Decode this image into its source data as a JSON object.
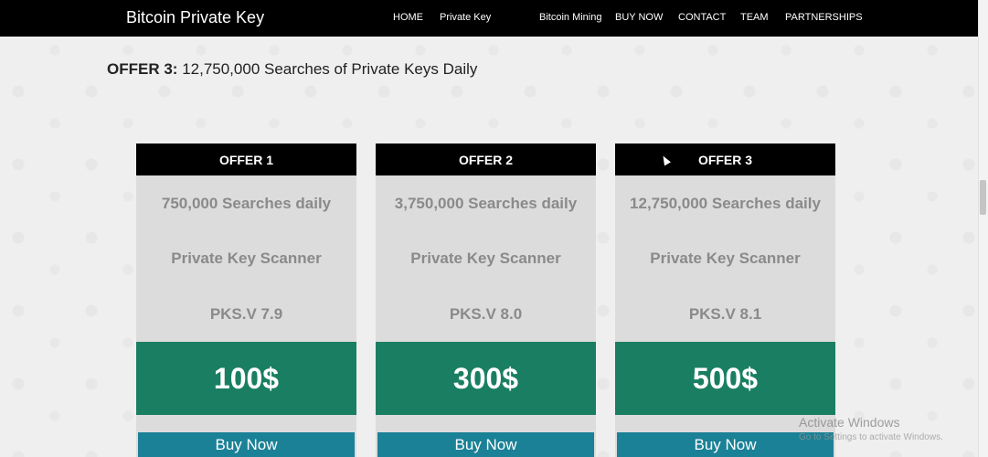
{
  "navbar": {
    "brand": "Bitcoin Private Key",
    "items": [
      "HOME",
      "Private Key",
      "Bitcoin Mining",
      "BUY NOW",
      "CONTACT",
      "TEAM",
      "PARTNERSHIPS"
    ]
  },
  "headline": {
    "label": "OFFER 3:",
    "text": "12,750,000 Searches of Private Keys Daily"
  },
  "offers": [
    {
      "title": "OFFER 1",
      "searches": "750,000 Searches daily",
      "product": "Private Key Scanner",
      "version": "PKS.V 7.9",
      "price": "100$",
      "button": "Buy Now"
    },
    {
      "title": "OFFER 2",
      "searches": "3,750,000 Searches daily",
      "product": "Private Key Scanner",
      "version": "PKS.V 8.0",
      "price": "300$",
      "button": "Buy Now"
    },
    {
      "title": "OFFER 3",
      "searches": "12,750,000 Searches daily",
      "product": "Private Key Scanner",
      "version": "PKS.V 8.1",
      "price": "500$",
      "button": "Buy Now"
    }
  ],
  "watermark": {
    "title": "Activate Windows",
    "subtitle": "Go to Settings to activate Windows."
  },
  "colors": {
    "navbar": "#000000",
    "price_box": "#1a7f62",
    "buy_button": "#1a8196",
    "card": "#dcdcdc"
  }
}
